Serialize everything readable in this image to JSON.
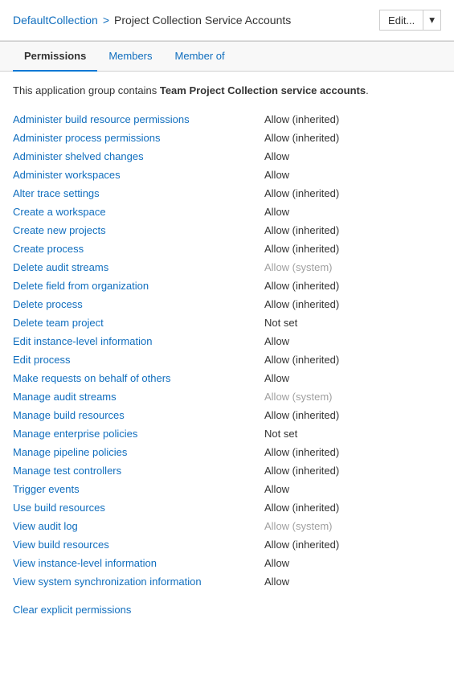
{
  "header": {
    "breadcrumb_link": "DefaultCollection",
    "breadcrumb_separator": ">",
    "breadcrumb_current": "Project Collection Service Accounts",
    "edit_label": "Edit...",
    "dropdown_icon": "▾"
  },
  "tabs": [
    {
      "label": "Permissions",
      "active": true
    },
    {
      "label": "Members",
      "active": false
    },
    {
      "label": "Member of",
      "active": false
    }
  ],
  "description": {
    "prefix": "This application group contains ",
    "highlight": "Team Project Collection service accounts",
    "suffix": "."
  },
  "permissions": [
    {
      "name": "Administer build resource permissions",
      "value": "Allow (inherited)",
      "type": "allow-inherited"
    },
    {
      "name": "Administer process permissions",
      "value": "Allow (inherited)",
      "type": "allow-inherited"
    },
    {
      "name": "Administer shelved changes",
      "value": "Allow",
      "type": "allow"
    },
    {
      "name": "Administer workspaces",
      "value": "Allow",
      "type": "allow"
    },
    {
      "name": "Alter trace settings",
      "value": "Allow (inherited)",
      "type": "allow-inherited"
    },
    {
      "name": "Create a workspace",
      "value": "Allow",
      "type": "allow"
    },
    {
      "name": "Create new projects",
      "value": "Allow (inherited)",
      "type": "allow-inherited"
    },
    {
      "name": "Create process",
      "value": "Allow (inherited)",
      "type": "allow-inherited"
    },
    {
      "name": "Delete audit streams",
      "value": "Allow (system)",
      "type": "allow-system"
    },
    {
      "name": "Delete field from organization",
      "value": "Allow (inherited)",
      "type": "allow-inherited"
    },
    {
      "name": "Delete process",
      "value": "Allow (inherited)",
      "type": "allow-inherited"
    },
    {
      "name": "Delete team project",
      "value": "Not set",
      "type": "not-set"
    },
    {
      "name": "Edit instance-level information",
      "value": "Allow",
      "type": "allow"
    },
    {
      "name": "Edit process",
      "value": "Allow (inherited)",
      "type": "allow-inherited"
    },
    {
      "name": "Make requests on behalf of others",
      "value": "Allow",
      "type": "allow"
    },
    {
      "name": "Manage audit streams",
      "value": "Allow (system)",
      "type": "allow-system"
    },
    {
      "name": "Manage build resources",
      "value": "Allow (inherited)",
      "type": "allow-inherited"
    },
    {
      "name": "Manage enterprise policies",
      "value": "Not set",
      "type": "not-set"
    },
    {
      "name": "Manage pipeline policies",
      "value": "Allow (inherited)",
      "type": "allow-inherited"
    },
    {
      "name": "Manage test controllers",
      "value": "Allow (inherited)",
      "type": "allow-inherited"
    },
    {
      "name": "Trigger events",
      "value": "Allow",
      "type": "allow"
    },
    {
      "name": "Use build resources",
      "value": "Allow (inherited)",
      "type": "allow-inherited"
    },
    {
      "name": "View audit log",
      "value": "Allow (system)",
      "type": "allow-system"
    },
    {
      "name": "View build resources",
      "value": "Allow (inherited)",
      "type": "allow-inherited"
    },
    {
      "name": "View instance-level information",
      "value": "Allow",
      "type": "allow"
    },
    {
      "name": "View system synchronization information",
      "value": "Allow",
      "type": "allow"
    }
  ],
  "clear_label": "Clear explicit permissions"
}
